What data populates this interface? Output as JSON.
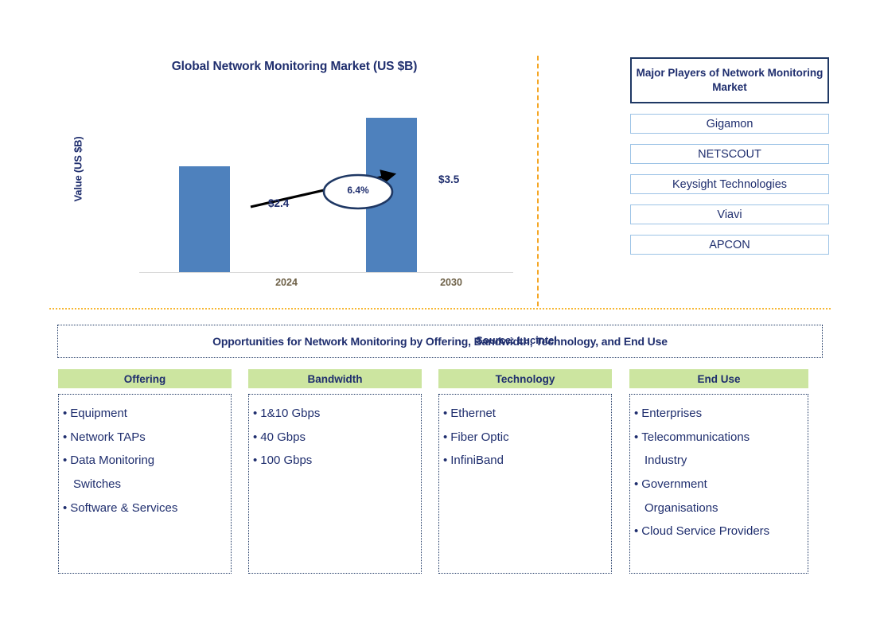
{
  "chart_data": {
    "type": "bar",
    "title": "Global Network Monitoring Market (US $B)",
    "ylabel": "Value (US $B)",
    "xlabel": "",
    "categories": [
      "2024",
      "2030"
    ],
    "values": [
      2.4,
      3.5
    ],
    "value_labels": [
      "$2.4",
      "$3.5"
    ],
    "ylim": [
      0,
      4.0
    ],
    "grid": false,
    "legend": null,
    "bar_color": "#4E81BD",
    "annotations": [
      {
        "type": "cagr-ellipse",
        "text": "6.4%",
        "from": "2024",
        "to": "2030"
      }
    ]
  },
  "source": {
    "text": "Source: Lucintel"
  },
  "players": {
    "header": "Major Players of Network Monitoring Market",
    "items": [
      "Gigamon",
      "NETSCOUT",
      "Keysight Technologies",
      "Viavi",
      "APCON"
    ]
  },
  "opportunities": {
    "title": "Opportunities for Network Monitoring by Offering, Bandwidth, Technology, and End Use",
    "columns": [
      {
        "header": "Offering",
        "items": [
          {
            "bullet": true,
            "text": "Equipment"
          },
          {
            "bullet": true,
            "text": "Network TAPs"
          },
          {
            "bullet": true,
            "text": "Data Monitoring"
          },
          {
            "bullet": false,
            "text": "Switches"
          },
          {
            "bullet": true,
            "text": "Software & Services"
          }
        ]
      },
      {
        "header": "Bandwidth",
        "items": [
          {
            "bullet": true,
            "text": "1&10 Gbps"
          },
          {
            "bullet": true,
            "text": "40 Gbps"
          },
          {
            "bullet": true,
            "text": "100 Gbps"
          }
        ]
      },
      {
        "header": "Technology",
        "items": [
          {
            "bullet": true,
            "text": "Ethernet"
          },
          {
            "bullet": true,
            "text": "Fiber Optic"
          },
          {
            "bullet": true,
            "text": "InfiniBand"
          }
        ]
      },
      {
        "header": "End Use",
        "items": [
          {
            "bullet": true,
            "text": "Enterprises"
          },
          {
            "bullet": true,
            "text": "Telecommunications"
          },
          {
            "bullet": false,
            "text": "Industry"
          },
          {
            "bullet": true,
            "text": "Government"
          },
          {
            "bullet": false,
            "text": "Organisations"
          },
          {
            "bullet": true,
            "text": "Cloud Service Providers"
          }
        ]
      }
    ]
  },
  "colors": {
    "navy": "#1F2E6E",
    "bar_blue": "#4E81BD",
    "green_header": "#CCE5A0",
    "divider_gold": "#F7B733",
    "player_border": "#9DC3E6"
  }
}
